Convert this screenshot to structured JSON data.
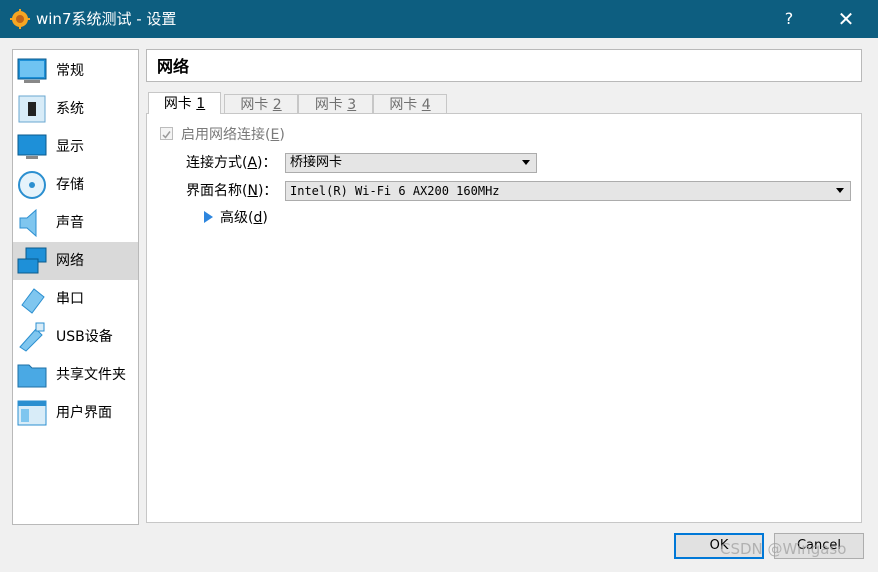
{
  "window": {
    "title": "win7系统测试 - 设置",
    "help_label": "?",
    "close_label": "✕"
  },
  "sidebar": {
    "items": [
      {
        "label": "常规",
        "icon": "general-icon"
      },
      {
        "label": "系统",
        "icon": "system-icon"
      },
      {
        "label": "显示",
        "icon": "display-icon"
      },
      {
        "label": "存储",
        "icon": "storage-icon"
      },
      {
        "label": "声音",
        "icon": "audio-icon"
      },
      {
        "label": "网络",
        "icon": "network-icon",
        "selected": true
      },
      {
        "label": "串口",
        "icon": "serial-port-icon"
      },
      {
        "label": "USB设备",
        "icon": "usb-icon"
      },
      {
        "label": "共享文件夹",
        "icon": "shared-folder-icon"
      },
      {
        "label": "用户界面",
        "icon": "user-interface-icon"
      }
    ]
  },
  "section_title": "网络",
  "tabs": [
    {
      "label": "网卡",
      "key": "1",
      "active": true
    },
    {
      "label": "网卡",
      "key": "2"
    },
    {
      "label": "网卡",
      "key": "3"
    },
    {
      "label": "网卡",
      "key": "4"
    }
  ],
  "adapter": {
    "enable_label": "启用网络连接",
    "enable_key": "E",
    "enabled": true,
    "attached_label": "连接方式",
    "attached_key": "A",
    "attached_value": "桥接网卡",
    "name_label": "界面名称",
    "name_key": "N",
    "name_value": "Intel(R) Wi-Fi 6 AX200 160MHz",
    "advanced_label": "高级",
    "advanced_key": "d"
  },
  "buttons": {
    "ok": "OK",
    "cancel": "Cancel"
  },
  "watermark": "CSDN @Wingaso",
  "colors": {
    "titlebar": "#0d5e80",
    "selection": "#d9d9d9",
    "accent": "#0078d7"
  }
}
